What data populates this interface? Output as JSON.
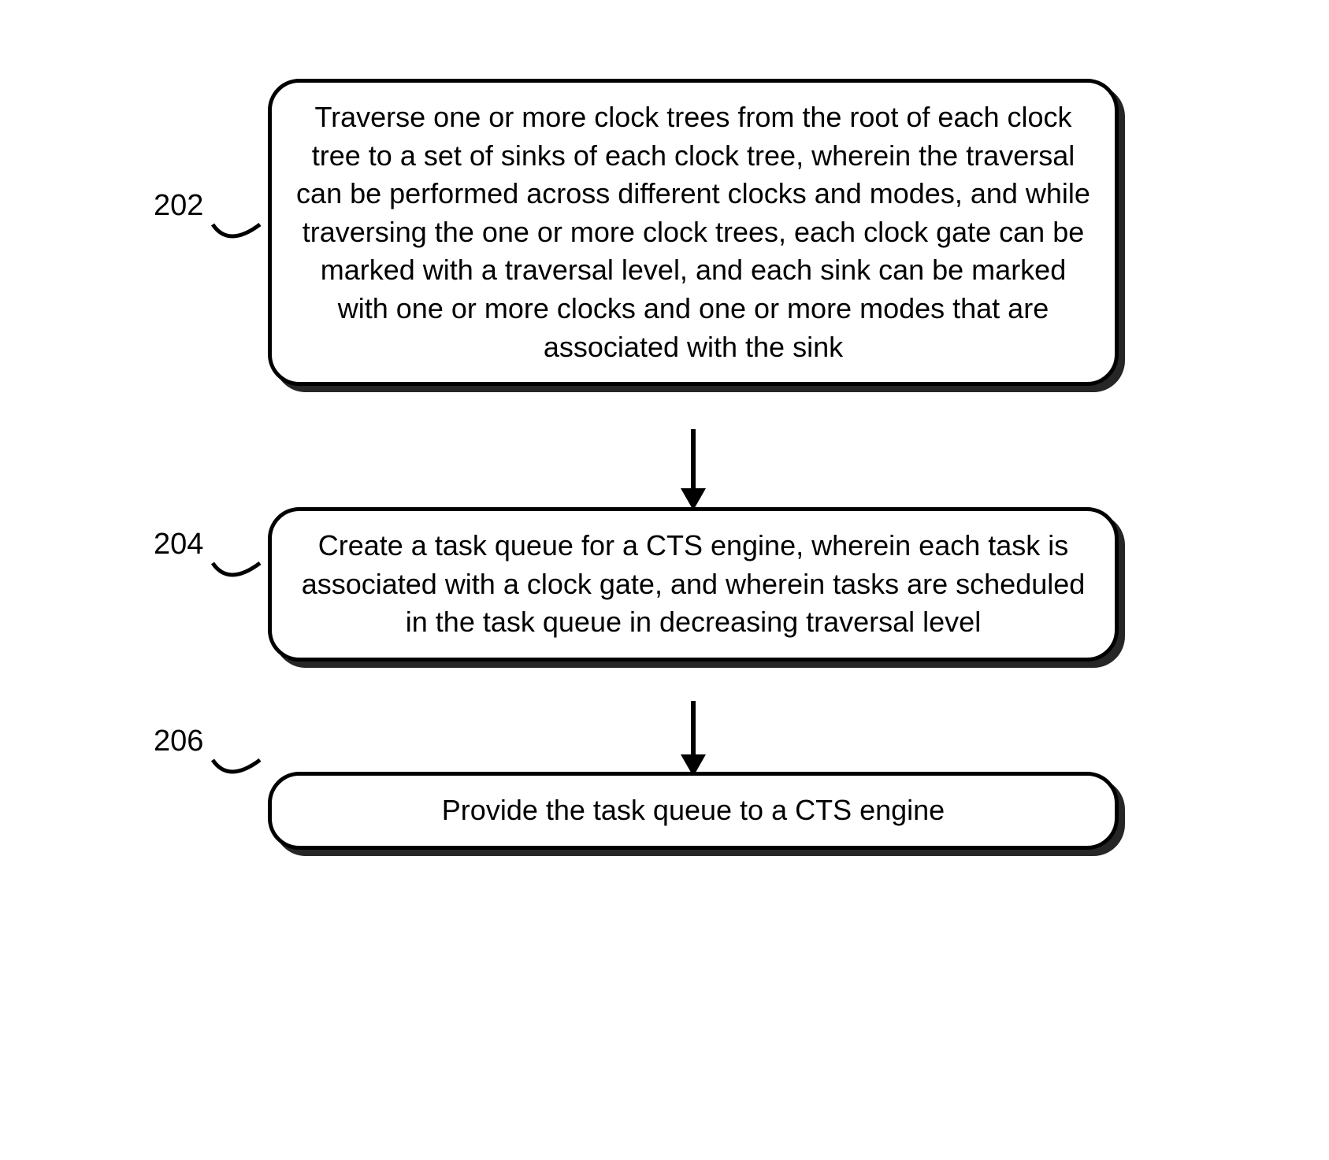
{
  "diagram": {
    "type": "flowchart",
    "steps": [
      {
        "label": "202",
        "text": "Traverse one or more clock trees from the root of each clock tree to a set of sinks of each clock tree, wherein the traversal can be performed across different clocks and modes, and while traversing the one or more clock trees, each clock gate can be marked with a traversal level, and each sink can be marked with one or more clocks and one or more modes that are associated with the sink"
      },
      {
        "label": "204",
        "text": "Create a task queue for a CTS engine, wherein each task is associated with a clock gate, and wherein tasks are scheduled in the task queue in decreasing traversal level"
      },
      {
        "label": "206",
        "text": "Provide the task queue to a CTS engine"
      }
    ]
  }
}
